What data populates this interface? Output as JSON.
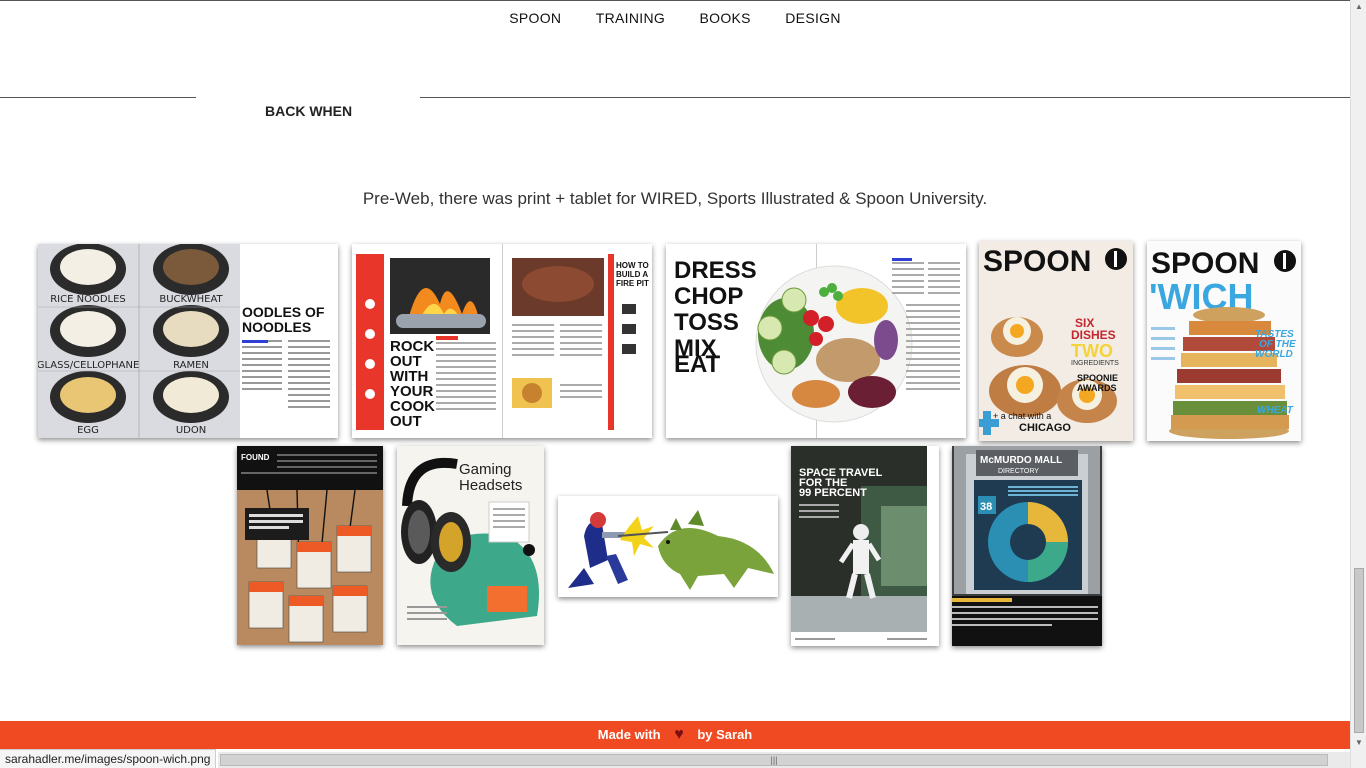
{
  "nav": {
    "items": [
      {
        "label": "SPOON"
      },
      {
        "label": "TRAINING"
      },
      {
        "label": "BOOKS"
      },
      {
        "label": "DESIGN"
      }
    ]
  },
  "section": {
    "title": "BACK WHEN"
  },
  "intro": {
    "text": "Pre-Web, there was print + tablet for WIRED, Sports Illustrated & Spoon University."
  },
  "gallery": {
    "noodles": {
      "labels": [
        "RICE NOODLES",
        "BUCKWHEAT",
        "GLASS/CELLOPHANE",
        "RAMEN",
        "EGG",
        "UDON"
      ],
      "title_1": "OODLES OF",
      "title_2": "NOODLES"
    },
    "firepit": {
      "headline": [
        "ROCK",
        "OUT",
        "WITH",
        "YOUR",
        "COOK",
        "OUT"
      ],
      "side_title": [
        "HOW TO",
        "BUILD A",
        "FIRE PIT"
      ]
    },
    "salad": {
      "headline": [
        "DRESS",
        "CHOP",
        "TOSS",
        "MIX",
        "EAT"
      ]
    },
    "spoon1": {
      "logo": "SPOON",
      "teaser_1": "SIX",
      "teaser_2": "DISHES",
      "teaser_3": "TWO",
      "teaser_4": "INGREDIENTS",
      "teaser_5": "SPOONIE",
      "teaser_6": "AWARDS",
      "teaser_7": "+ a chat with a",
      "teaser_8": "CHICAGO"
    },
    "spoon2": {
      "logo": "SPOON",
      "title": "'WICH",
      "side_1": "TASTES",
      "side_2": "OF THE",
      "side_3": "WORLD",
      "side_4": "WHEAT"
    },
    "found": {
      "title": "FOUND"
    },
    "headsets": {
      "title_1": "Gaming",
      "title_2": "Headsets"
    },
    "space": {
      "title_1": "SPACE TRAVEL",
      "title_2": "FOR THE",
      "title_3": "99 PERCENT"
    },
    "mall": {
      "title_1": "McMURDO MALL",
      "title_2": "DIRECTORY",
      "level": "38"
    }
  },
  "footer": {
    "made_with": "Made with",
    "by": "by Sarah"
  },
  "status": {
    "url": "sarahadler.me/images/spoon-wich.png"
  },
  "colors": {
    "accent": "#f04a23",
    "heart": "#7a1010"
  }
}
